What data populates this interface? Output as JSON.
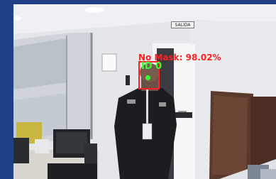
{
  "feed": {
    "detection_label": "No Mask: 98.02%",
    "track_id": "ID 0",
    "exit_sign": "SALIDA"
  },
  "colors": {
    "frame_border": "#1f3f86",
    "detection_box": "#ff2020",
    "id_text": "#33ff33"
  }
}
